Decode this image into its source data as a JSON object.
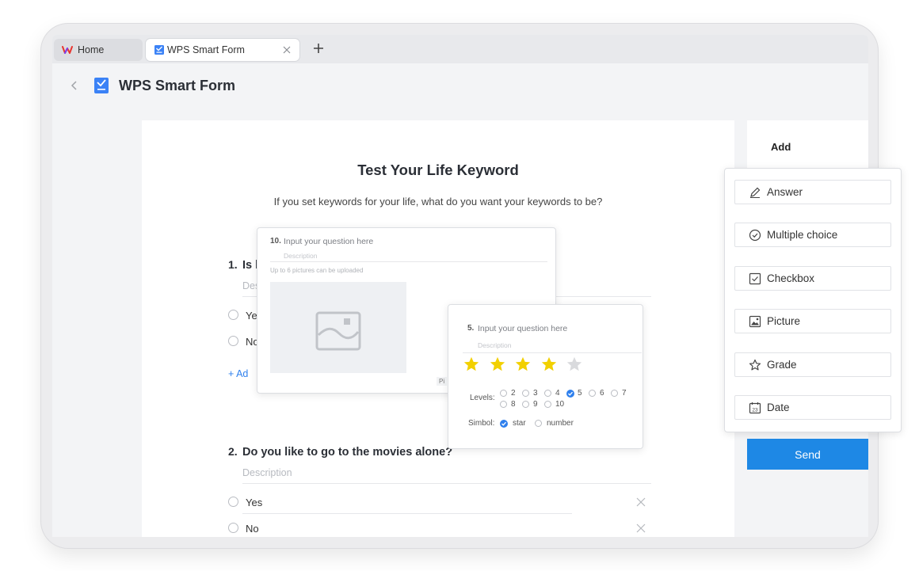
{
  "tabs": {
    "home": "Home",
    "active": "WPS Smart Form"
  },
  "header": {
    "title": "WPS Smart Form"
  },
  "form": {
    "title": "Test Your Life Keyword",
    "description": "If you set keywords for your life, what do you want your keywords to be?",
    "q1": {
      "num": "1.",
      "text": "Is l",
      "desc": "Des",
      "opt1": "Yes",
      "opt2": "No",
      "add": "+ Ad"
    },
    "q2": {
      "num": "2.",
      "text": "Do you like to go to the movies alone?",
      "desc": "Description",
      "opt1": "Yes",
      "opt2": "No"
    }
  },
  "picture_card": {
    "num": "10.",
    "question": "Input your question here",
    "desc": "Description",
    "note": "Up to 6 pictures can be uploaded",
    "cut_label": "Pi"
  },
  "grade_card": {
    "num": "5.",
    "question": "Input your question here",
    "desc": "Description",
    "rating": 4,
    "max_rating": 5,
    "levels_label": "Levels:",
    "levels_row1": [
      "2",
      "3",
      "4",
      "5",
      "6",
      "7"
    ],
    "levels_row2": [
      "8",
      "9",
      "10"
    ],
    "selected_level": "5",
    "symbol_label": "Simbol:",
    "symbol_star": "star",
    "symbol_number": "number"
  },
  "sidebar": {
    "title": "Add",
    "send": "Send"
  },
  "add_menu": {
    "items": [
      "Answer",
      "Multiple choice",
      "Checkbox",
      "Picture",
      "Grade",
      "Date"
    ]
  },
  "colors": {
    "accent": "#1e88e5",
    "star": "#f2d000",
    "star_empty": "#d9dadd"
  }
}
